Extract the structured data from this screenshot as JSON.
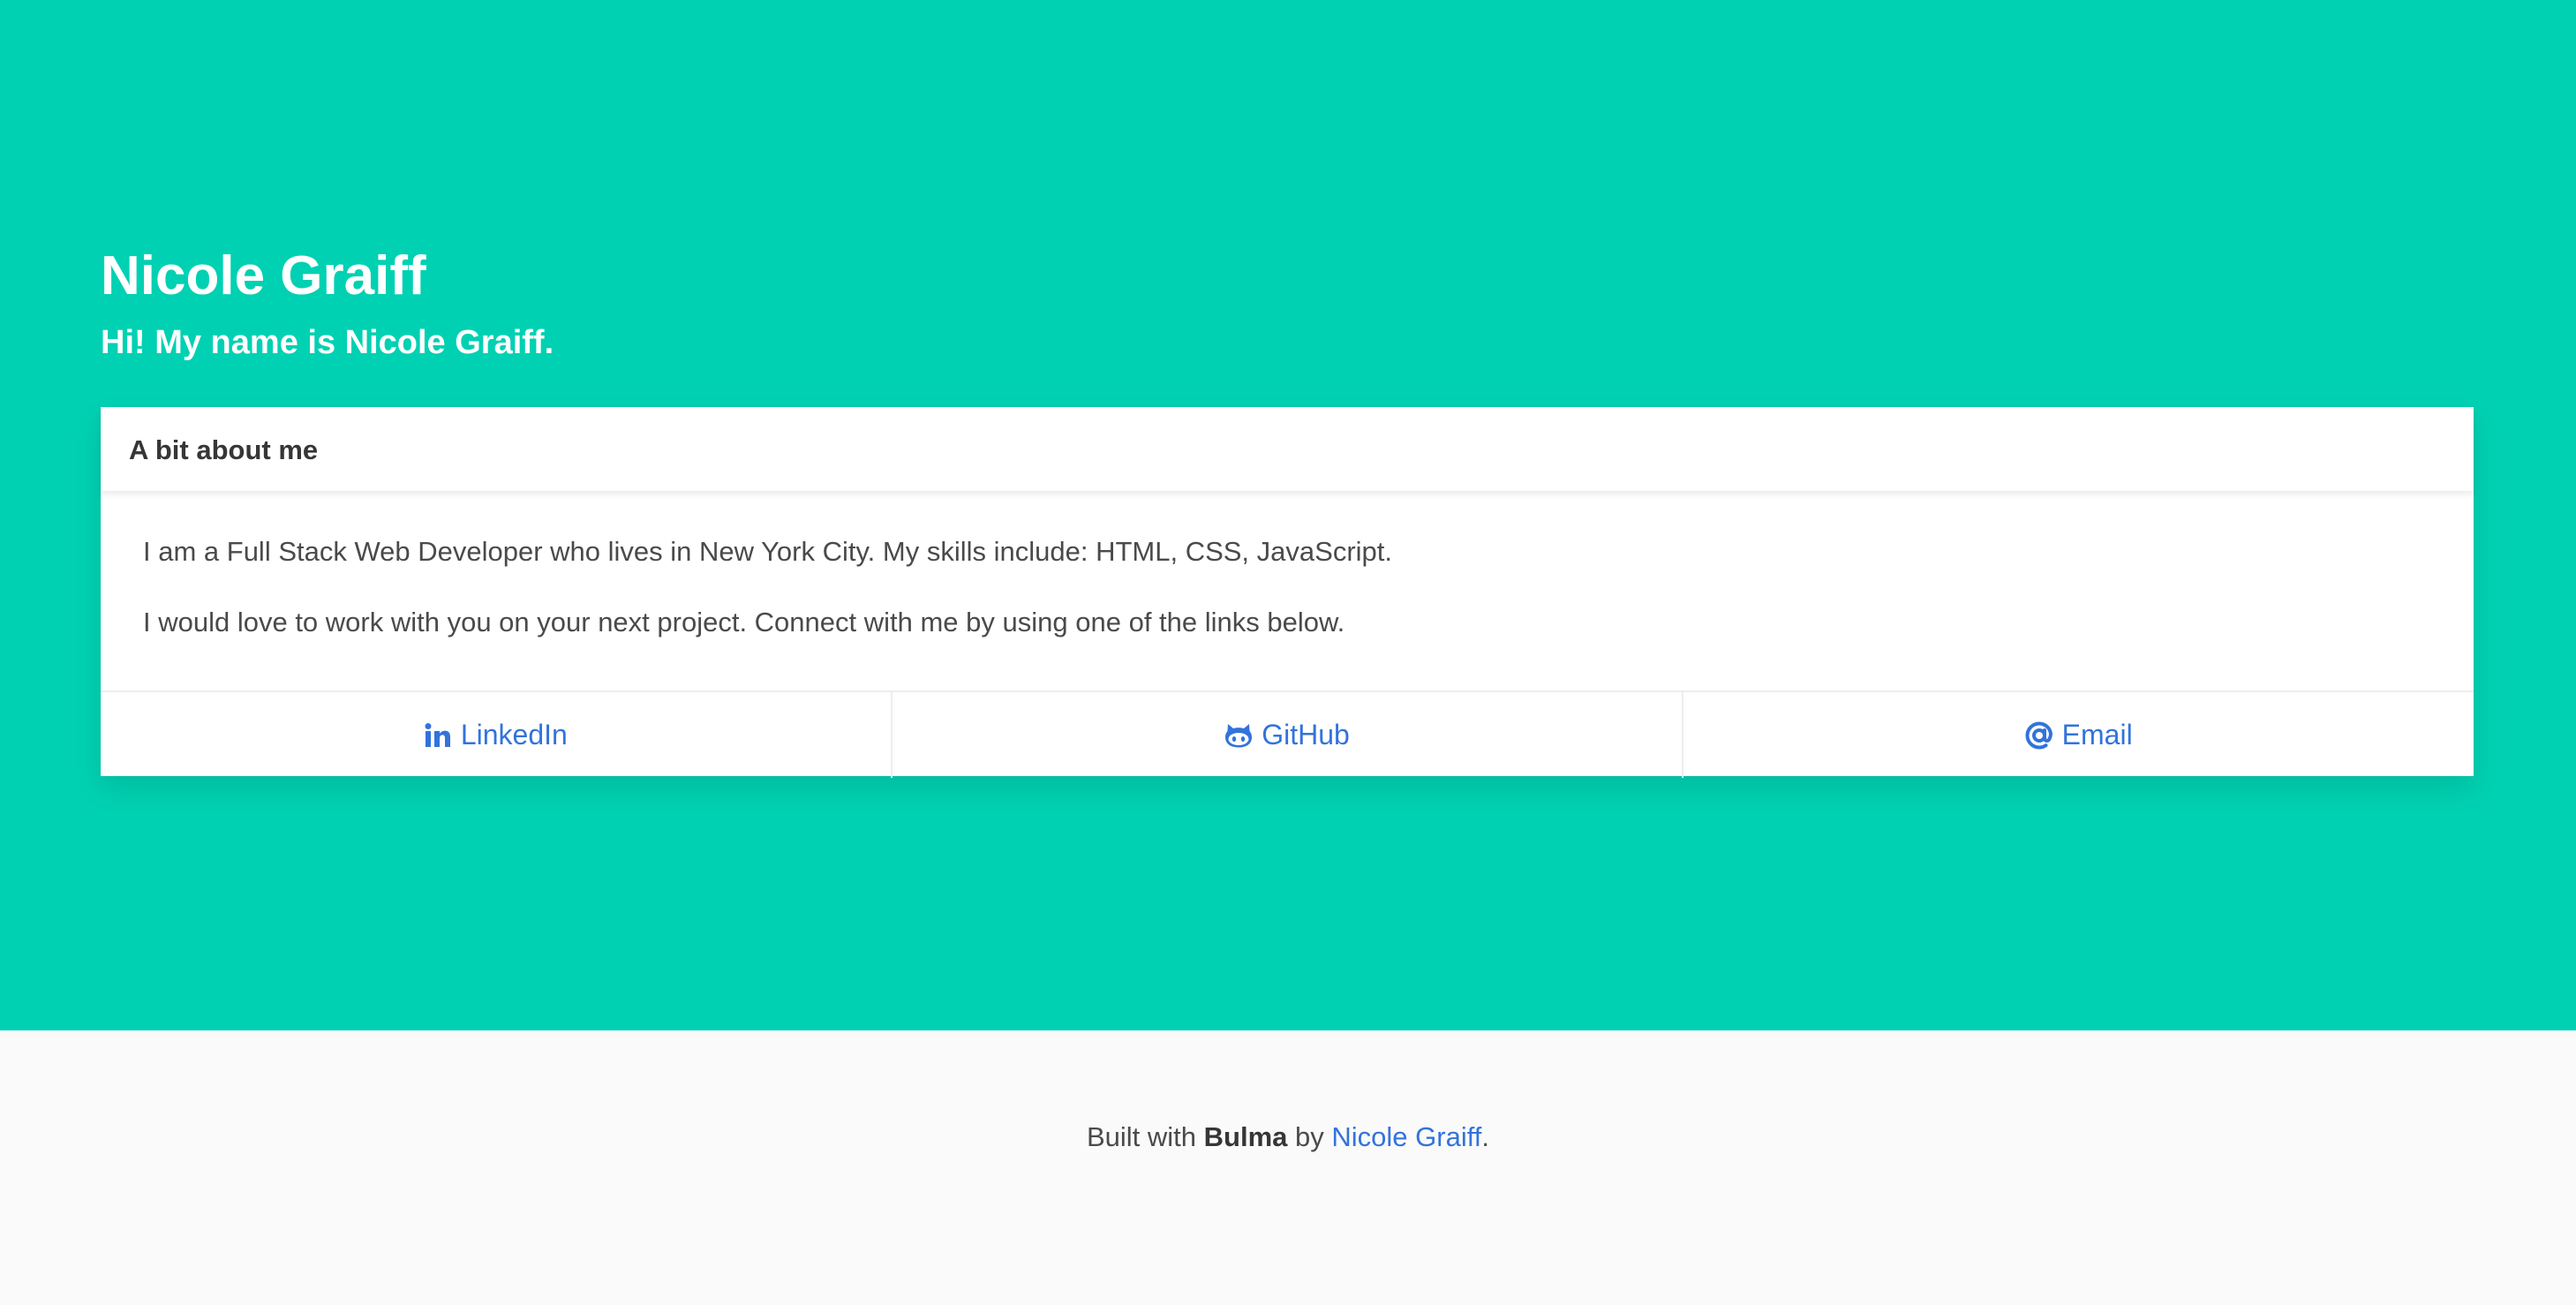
{
  "hero": {
    "title": "Nicole Graiff",
    "subtitle": "Hi! My name is Nicole Graiff.",
    "background_color": "#00d1b2"
  },
  "card": {
    "header_title": "A bit about me",
    "paragraphs": [
      "I am a Full Stack Web Developer who lives in New York City. My skills include: HTML, CSS, JavaScript.",
      "I would love to work with you on your next project. Connect with me by using one of the links below."
    ],
    "links": [
      {
        "label": "LinkedIn",
        "icon": "linkedin-icon"
      },
      {
        "label": "GitHub",
        "icon": "github-icon"
      },
      {
        "label": "Email",
        "icon": "at-sign-icon"
      }
    ],
    "link_color": "#3273dc"
  },
  "footer": {
    "prefix": "Built with",
    "framework": "Bulma",
    "by_text": "by",
    "author": "Nicole Graiff",
    "suffix": "."
  }
}
